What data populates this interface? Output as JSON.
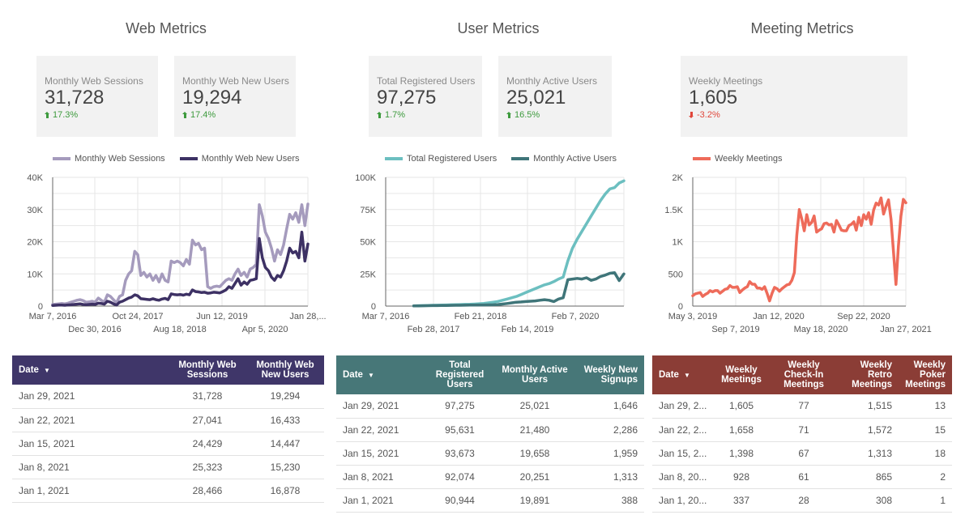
{
  "sections": [
    {
      "title": "Web Metrics",
      "scorecards": [
        {
          "label": "Monthly Web Sessions",
          "value": "31,728",
          "delta": "17.3%",
          "direction": "up"
        },
        {
          "label": "Monthly Web New Users",
          "value": "19,294",
          "delta": "17.4%",
          "direction": "up"
        }
      ]
    },
    {
      "title": "User Metrics",
      "scorecards": [
        {
          "label": "Total Registered Users",
          "value": "97,275",
          "delta": "1.7%",
          "direction": "up"
        },
        {
          "label": "Monthly Active Users",
          "value": "25,021",
          "delta": "16.5%",
          "direction": "up"
        }
      ]
    },
    {
      "title": "Meeting Metrics",
      "scorecards": [
        {
          "label": "Weekly Meetings",
          "value": "1,605",
          "delta": "-3.2%",
          "direction": "down"
        }
      ]
    }
  ],
  "colors": {
    "web_sessions": "#a59bbd",
    "web_new_users": "#3d3164",
    "registered_users": "#6cbfc0",
    "active_users": "#3f7579",
    "weekly_meetings": "#ee6b5a",
    "delta_up": "#3d9a3d",
    "delta_down": "#e0463a",
    "web_header": "#3f3669",
    "user_header": "#477778",
    "meeting_header": "#8b3d36"
  },
  "chart_data": [
    {
      "type": "line",
      "title": "",
      "xlabel": "",
      "ylabel": "",
      "x_range": [
        "Mar 7, 2016",
        "Jan 28, 2021"
      ],
      "ylim": [
        0,
        40000
      ],
      "yticks": [
        "0",
        "10K",
        "20K",
        "30K",
        "40K"
      ],
      "xticks_row1": [
        "Mar 7, 2016",
        "Oct 24, 2017",
        "Jun 12, 2019",
        "Jan 28,..."
      ],
      "xticks_row2": [
        "Dec 30, 2016",
        "Aug 18, 2018",
        "Apr 5, 2020"
      ],
      "grid": true,
      "legend": "top",
      "series": [
        {
          "name": "Monthly Web Sessions",
          "color_key": "web_sessions",
          "values": [
            500,
            600,
            700,
            800,
            700,
            900,
            1200,
            1500,
            1800,
            2000,
            1700,
            1200,
            1300,
            1500,
            1200,
            2500,
            1800,
            1200,
            3500,
            3000,
            2000,
            1000,
            3000,
            3500,
            8000,
            10000,
            11000,
            17000,
            16000,
            9500,
            10500,
            9000,
            10000,
            8000,
            9500,
            7500,
            10000,
            8000,
            7500,
            14000,
            13500,
            14000,
            13500,
            12500,
            14500,
            13000,
            20500,
            19000,
            19500,
            17500,
            18000,
            6000,
            5500,
            6000,
            6200,
            6000,
            7000,
            8000,
            8500,
            8000,
            10000,
            11500,
            9500,
            10500,
            9000,
            11500,
            12000,
            13000,
            31500,
            28000,
            23000,
            21000,
            18000,
            14000,
            17500,
            16000,
            19000,
            24000,
            28500,
            27000,
            29000,
            26000,
            31500,
            25000,
            31700
          ]
        },
        {
          "name": "Monthly Web New Users",
          "color_key": "web_new_users",
          "values": [
            200,
            250,
            300,
            300,
            250,
            350,
            400,
            500,
            600,
            700,
            500,
            400,
            500,
            600,
            500,
            900,
            800,
            600,
            1500,
            1200,
            700,
            300,
            1200,
            1500,
            2000,
            2500,
            2800,
            3500,
            3200,
            2300,
            2200,
            2100,
            2000,
            2300,
            2000,
            1800,
            2200,
            2400,
            2000,
            3800,
            3600,
            3500,
            3600,
            3400,
            3700,
            3500,
            5000,
            4500,
            4400,
            4200,
            4300,
            4000,
            4100,
            4300,
            4200,
            4100,
            4500,
            5000,
            6000,
            5500,
            7000,
            8500,
            6500,
            7500,
            6800,
            8000,
            8200,
            8500,
            21000,
            15000,
            12000,
            11000,
            9000,
            8000,
            9500,
            9000,
            11000,
            14000,
            18000,
            16500,
            17000,
            15000,
            23000,
            14000,
            19300
          ]
        }
      ]
    },
    {
      "type": "line",
      "title": "",
      "xlabel": "",
      "ylabel": "",
      "x_range": [
        "Mar 7, 2016",
        "Jan 29, 2021"
      ],
      "ylim": [
        0,
        100000
      ],
      "yticks": [
        "0",
        "25K",
        "50K",
        "75K",
        "100K"
      ],
      "xticks_row1": [
        "Mar 7, 2016",
        "Feb 21, 2018",
        "Feb 7, 2020"
      ],
      "xticks_row2": [
        "Feb 28, 2017",
        "Feb 14, 2019"
      ],
      "grid": true,
      "legend": "top",
      "series": [
        {
          "name": "Total Registered Users",
          "color_key": "registered_users",
          "values": [
            null,
            null,
            null,
            null,
            null,
            null,
            200,
            300,
            400,
            500,
            600,
            700,
            800,
            900,
            1000,
            1100,
            1200,
            1300,
            1400,
            1600,
            1800,
            2100,
            2500,
            3000,
            3600,
            4500,
            5500,
            6500,
            7500,
            9000,
            10500,
            12000,
            13500,
            15000,
            16500,
            17500,
            19000,
            21000,
            22500,
            35000,
            45000,
            52000,
            58000,
            64000,
            70000,
            76000,
            82000,
            87000,
            91000,
            92000,
            95600,
            97300
          ]
        },
        {
          "name": "Monthly Active Users",
          "color_key": "active_users",
          "values": [
            null,
            null,
            null,
            null,
            null,
            null,
            150,
            200,
            250,
            300,
            350,
            400,
            450,
            500,
            550,
            600,
            650,
            700,
            750,
            800,
            850,
            900,
            950,
            1000,
            1200,
            1600,
            2000,
            2500,
            3000,
            3200,
            3500,
            3800,
            4000,
            4500,
            5000,
            4500,
            3500,
            5500,
            6500,
            20500,
            21000,
            21500,
            21000,
            22000,
            20000,
            21000,
            23000,
            24000,
            25500,
            26000,
            19800,
            25000
          ]
        }
      ]
    },
    {
      "type": "line",
      "title": "",
      "xlabel": "",
      "ylabel": "",
      "x_range": [
        "May 3, 2019",
        "Jan 29, 2021"
      ],
      "ylim": [
        0,
        2000
      ],
      "yticks": [
        "0",
        "500",
        "1K",
        "1.5K",
        "2K"
      ],
      "xticks_row1": [
        "May 3, 2019",
        "Jan 12, 2020",
        "Sep 22, 2020"
      ],
      "xticks_row2": [
        "Sep 7, 2019",
        "May 18, 2020",
        "Jan 27, 2021"
      ],
      "grid": true,
      "legend": "top",
      "series": [
        {
          "name": "Weekly Meetings",
          "color_key": "weekly_meetings",
          "values": [
            160,
            190,
            200,
            210,
            150,
            180,
            200,
            240,
            220,
            240,
            240,
            200,
            230,
            260,
            270,
            320,
            290,
            290,
            300,
            210,
            250,
            280,
            300,
            380,
            340,
            340,
            280,
            280,
            260,
            300,
            200,
            80,
            200,
            290,
            270,
            230,
            270,
            300,
            330,
            340,
            400,
            520,
            1100,
            1500,
            1350,
            1170,
            1420,
            1260,
            1300,
            1400,
            1150,
            1180,
            1200,
            1280,
            1290,
            1260,
            1270,
            1150,
            1330,
            1260,
            1180,
            1170,
            1170,
            1250,
            1270,
            1310,
            1180,
            1380,
            1250,
            1420,
            1350,
            1450,
            1270,
            1490,
            1600,
            1570,
            1680,
            1430,
            1550,
            1650,
            1350,
            850,
            337,
            928,
            1398,
            1658,
            1605
          ]
        }
      ]
    }
  ],
  "tables": [
    {
      "name": "web",
      "headers": [
        "Date",
        "Monthly Web Sessions",
        "Monthly Web New Users"
      ],
      "sort_indicator": "▼",
      "rows": [
        [
          "Jan 29, 2021",
          "31,728",
          "19,294"
        ],
        [
          "Jan 22, 2021",
          "27,041",
          "16,433"
        ],
        [
          "Jan 15, 2021",
          "24,429",
          "14,447"
        ],
        [
          "Jan 8, 2021",
          "25,323",
          "15,230"
        ],
        [
          "Jan 1, 2021",
          "28,466",
          "16,878"
        ]
      ]
    },
    {
      "name": "users",
      "headers": [
        "Date",
        "Total Registered Users",
        "Monthly Active Users",
        "Weekly New Signups"
      ],
      "sort_indicator": "▼",
      "rows": [
        [
          "Jan 29, 2021",
          "97,275",
          "25,021",
          "1,646"
        ],
        [
          "Jan 22, 2021",
          "95,631",
          "21,480",
          "2,286"
        ],
        [
          "Jan 15, 2021",
          "93,673",
          "19,658",
          "1,959"
        ],
        [
          "Jan 8, 2021",
          "92,074",
          "20,251",
          "1,313"
        ],
        [
          "Jan 1, 2021",
          "90,944",
          "19,891",
          "388"
        ]
      ]
    },
    {
      "name": "meetings",
      "headers": [
        "Date",
        "Weekly Meetings",
        "Weekly Check-In Meetings",
        "Weekly Retro Meetings",
        "Weekly Poker Meetings"
      ],
      "sort_indicator": "▼",
      "rows": [
        [
          "Jan 29, 2...",
          "1,605",
          "77",
          "1,515",
          "13"
        ],
        [
          "Jan 22, 2...",
          "1,658",
          "71",
          "1,572",
          "15"
        ],
        [
          "Jan 15, 2...",
          "1,398",
          "67",
          "1,313",
          "18"
        ],
        [
          "Jan 8, 20...",
          "928",
          "61",
          "865",
          "2"
        ],
        [
          "Jan 1, 20...",
          "337",
          "28",
          "308",
          "1"
        ]
      ]
    }
  ]
}
